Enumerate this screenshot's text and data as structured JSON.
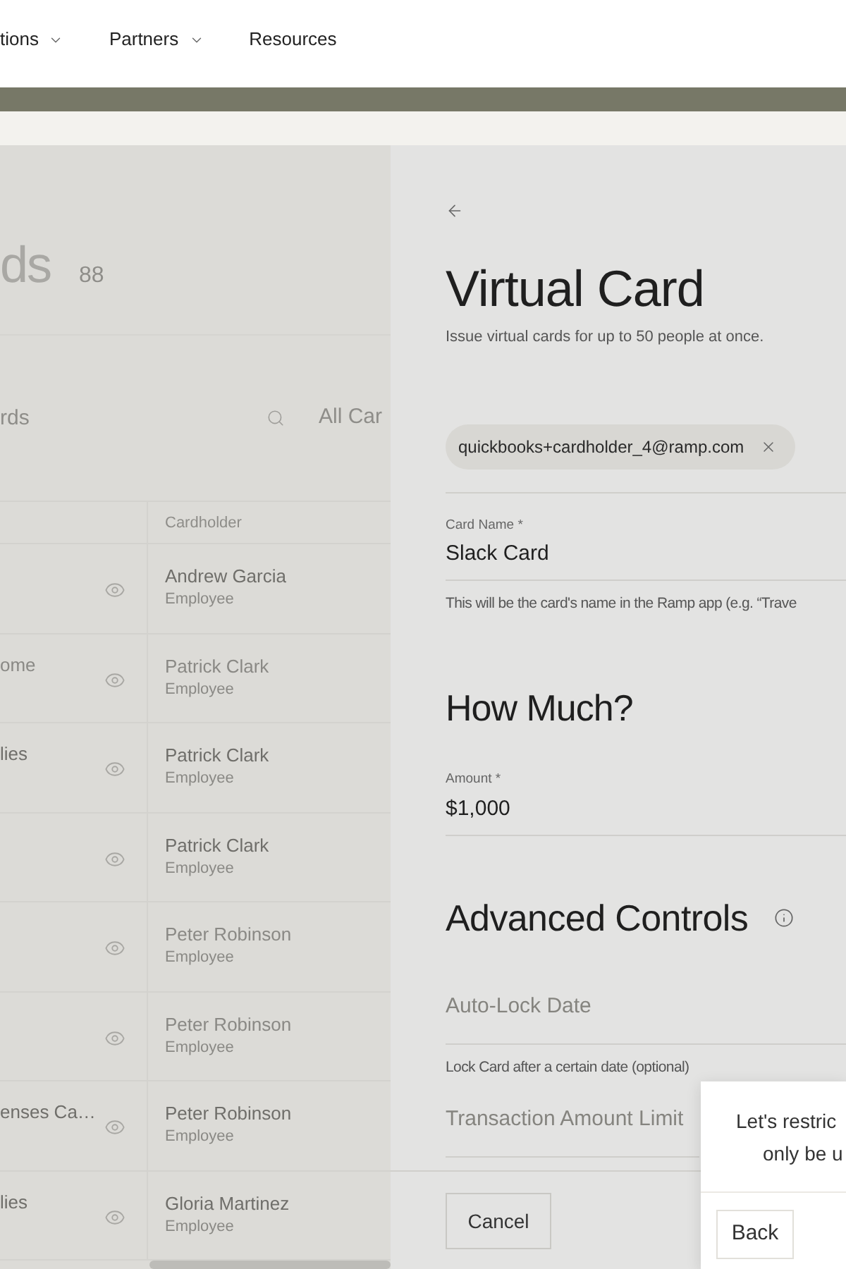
{
  "nav": {
    "items": [
      {
        "label": "tions",
        "has_menu": true
      },
      {
        "label": "Partners",
        "has_menu": true
      },
      {
        "label": "Resources",
        "has_menu": false
      }
    ]
  },
  "cards_list": {
    "title": "ds",
    "count": "88",
    "search": {
      "placeholder": "rds"
    },
    "filter": "All Car",
    "table": {
      "header": "Cardholder",
      "rows": [
        {
          "name": "Andrew Garcia",
          "role": "Employee",
          "dimmed": false
        },
        {
          "column_1": "ome",
          "name": "Patrick Clark",
          "role": "Employee",
          "dimmed": true
        },
        {
          "column_1": "lies",
          "name": "Patrick Clark",
          "role": "Employee",
          "dimmed": false
        },
        {
          "name": "Patrick Clark",
          "role": "Employee",
          "dimmed": false
        },
        {
          "name": "Peter Robinson",
          "role": "Employee",
          "dimmed": true
        },
        {
          "name": "Peter Robinson",
          "role": "Employee",
          "dimmed": true
        },
        {
          "column_1": "enses Ca…",
          "name": "Peter Robinson",
          "role": "Employee",
          "dimmed": false
        },
        {
          "column_1": "lies",
          "name": "Gloria Martinez",
          "role": "Employee",
          "dimmed": false
        }
      ]
    }
  },
  "virtual_card_panel": {
    "title": "Virtual Card",
    "subtitle": "Issue virtual cards for up to 50 people at once.",
    "recipients": [
      {
        "email": "quickbooks+cardholder_4@ramp.com"
      }
    ],
    "card_name": {
      "label": "Card Name *",
      "value": "Slack Card",
      "help": "This will be the card's name in the Ramp app (e.g. “Trave"
    },
    "how_much": {
      "heading": "How Much?",
      "amount": {
        "label": "Amount *",
        "value": "$1,000"
      }
    },
    "advanced_controls": {
      "heading": "Advanced Controls",
      "auto_lock": {
        "placeholder": "Auto-Lock Date",
        "help": "Lock Card after a certain date (optional)"
      },
      "transaction_limit": {
        "placeholder": "Transaction Amount Limit"
      }
    },
    "footer": {
      "cancel": "Cancel"
    }
  },
  "popover": {
    "lines": [
      "Let's restric",
      "only be u"
    ],
    "back": "Back"
  }
}
